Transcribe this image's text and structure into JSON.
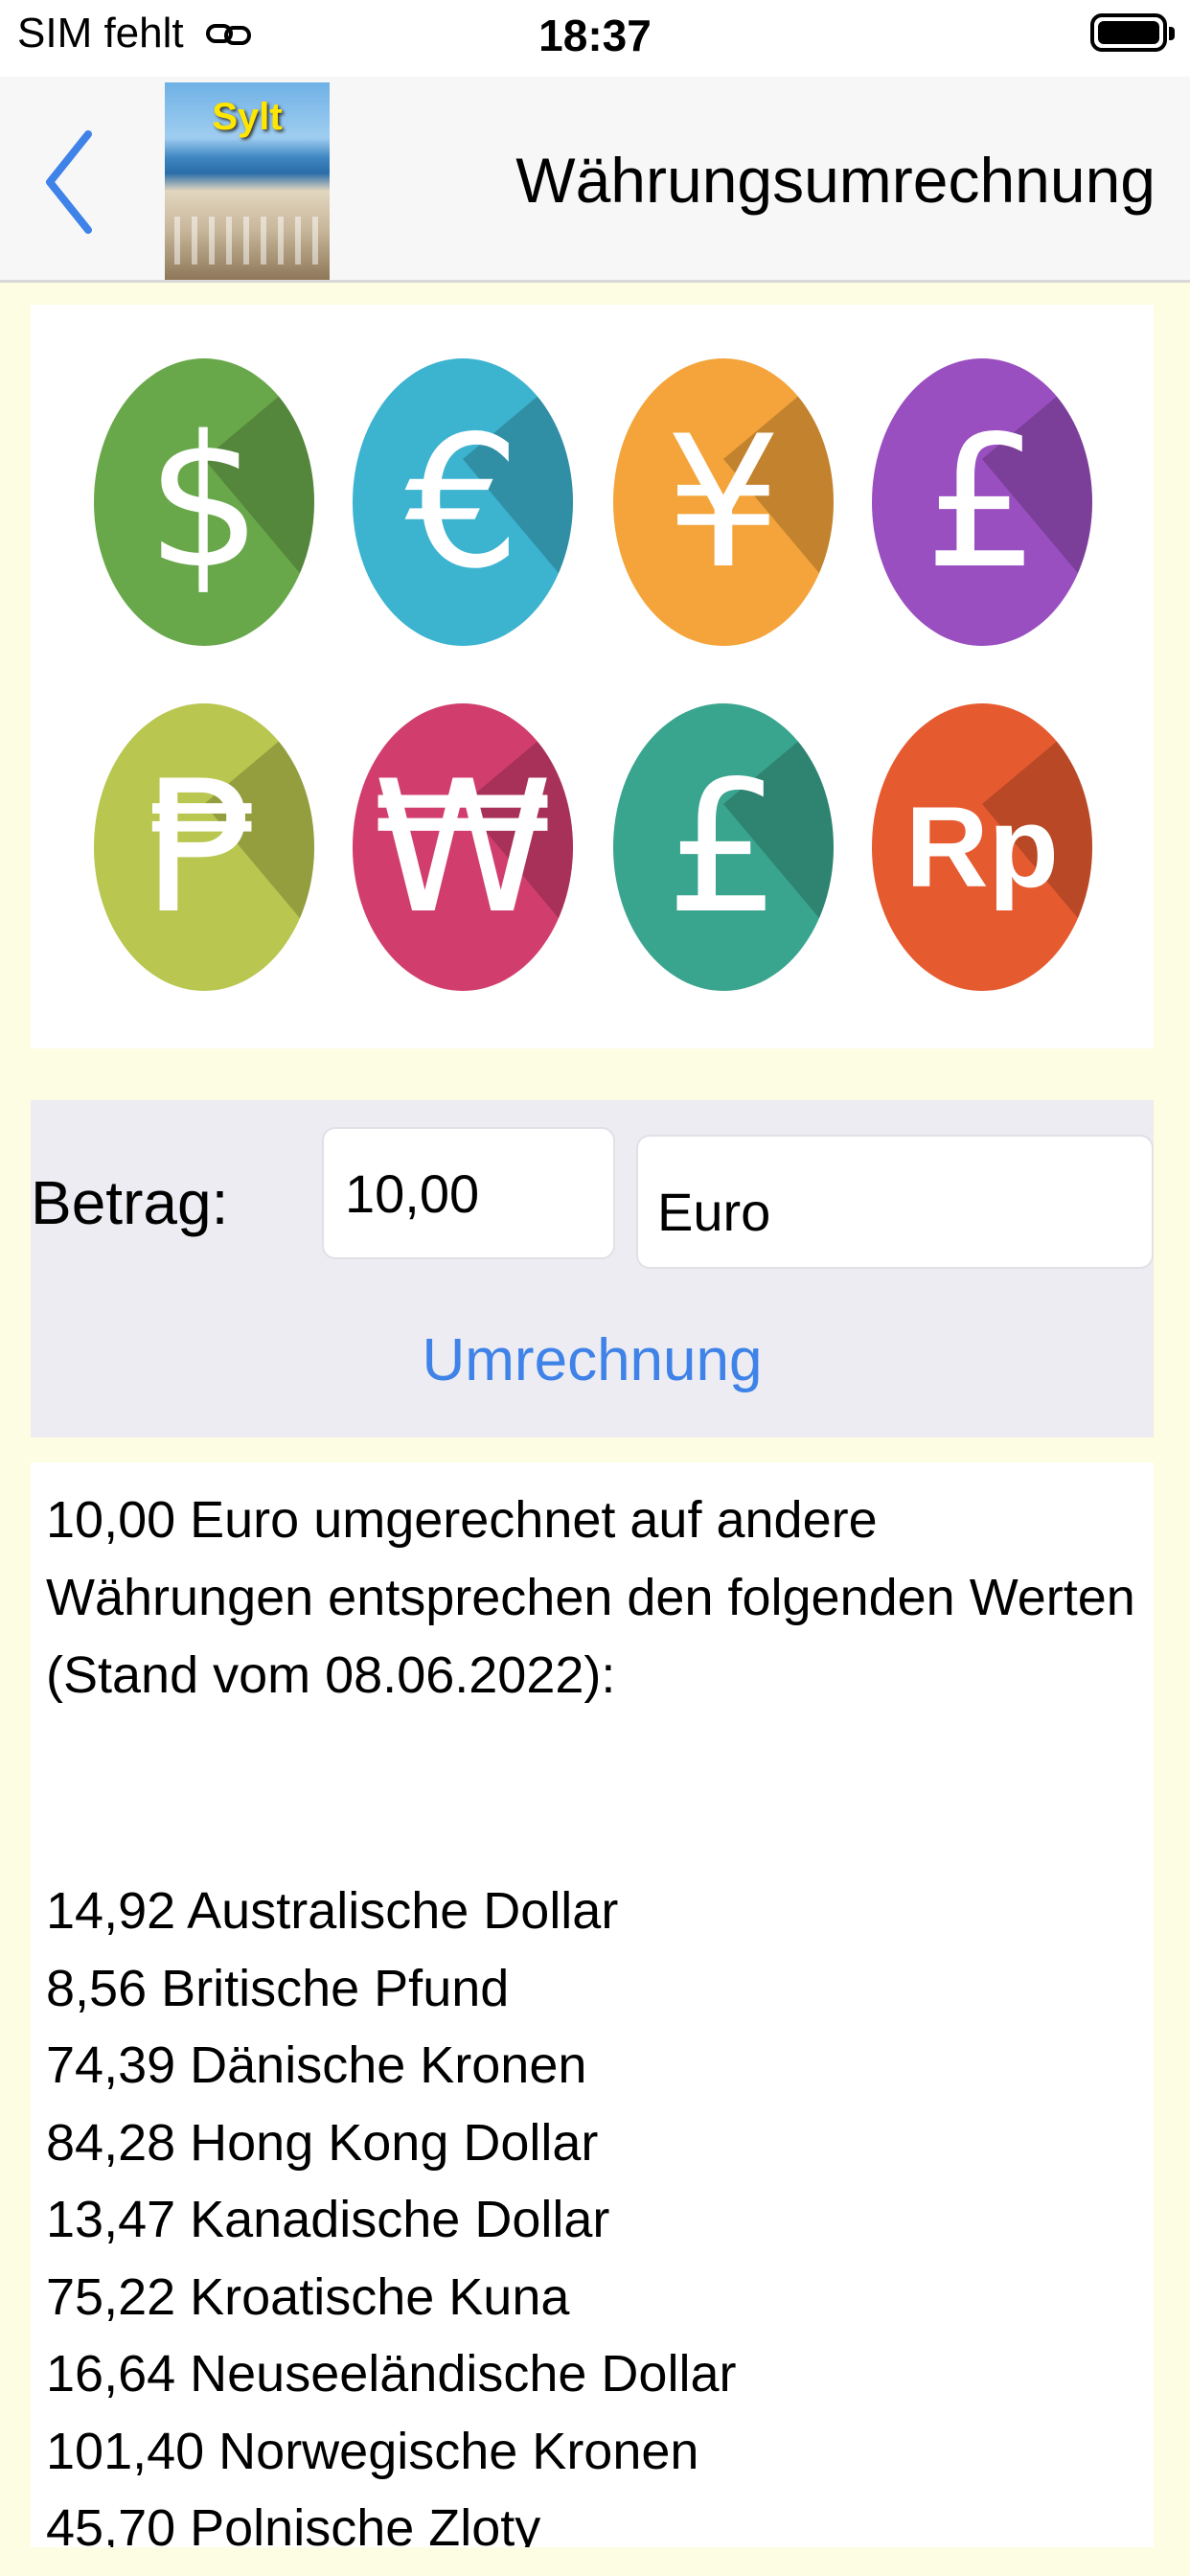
{
  "status_bar": {
    "carrier": "SIM fehlt",
    "time": "18:37"
  },
  "nav": {
    "thumbnail_title": "Sylt",
    "title": "Währungsumrechnung"
  },
  "coins": [
    {
      "symbol": "$",
      "color": "#69a84a"
    },
    {
      "symbol": "€",
      "color": "#3cb3cf"
    },
    {
      "symbol": "¥",
      "color": "#f4a43a"
    },
    {
      "symbol": "£",
      "color": "#9a4fc0"
    },
    {
      "symbol": "₱",
      "color": "#b9c64f"
    },
    {
      "symbol": "₩",
      "color": "#d13e6e"
    },
    {
      "symbol": "£",
      "color": "#3aa58e"
    },
    {
      "symbol": "Rp",
      "color": "#e65a30"
    }
  ],
  "form": {
    "amount_label": "Betrag:",
    "amount_value": "10,00",
    "currency_value": "Euro",
    "convert_label": "Umrechnung"
  },
  "results": {
    "intro": "10,00 Euro umgerechnet auf andere Währungen entsprechen den folgenden Werten (Stand vom 08.06.2022):",
    "items": [
      "14,92 Australische Dollar",
      "8,56 Britische Pfund",
      "74,39 Dänische Kronen",
      "84,28 Hong Kong Dollar",
      "13,47 Kanadische Dollar",
      "75,22 Kroatische Kuna",
      "16,64 Neuseeländische Dollar",
      "101,40 Norwegische Kronen",
      "45,70 Polnische Zloty"
    ]
  },
  "colors": {
    "accent": "#3f82e8",
    "page_background": "#fdfde4",
    "panel": "#ececf2"
  }
}
